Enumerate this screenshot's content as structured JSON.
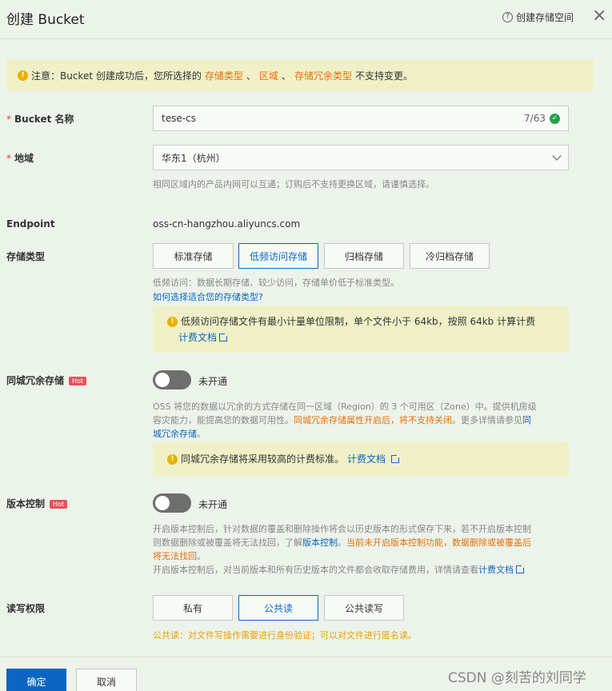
{
  "header": {
    "title": "创建 Bucket",
    "help_icon": "?",
    "help_link": "创建存储空间",
    "close_icon": "×"
  },
  "notice": {
    "prefix": "注意：Bucket 创建成功后，您所选择的",
    "hl1": "存储类型",
    "sep1": "、",
    "hl2": "区域",
    "sep2": "、",
    "hl3": "存储冗余类型",
    "suffix": "不支持变更。"
  },
  "bucket_name": {
    "required_mark": "*",
    "label": "Bucket 名称",
    "value": "tese-cs",
    "count": "7/63"
  },
  "region": {
    "required_mark": "*",
    "label": "地域",
    "value": "华东1（杭州）",
    "help": "相同区域内的产品内网可以互通；订购后不支持更换区域，请谨慎选择。"
  },
  "endpoint": {
    "label": "Endpoint",
    "value": "oss-cn-hangzhou.aliyuncs.com"
  },
  "storage_class": {
    "label": "存储类型",
    "options": [
      "标准存储",
      "低频访问存储",
      "归档存储",
      "冷归档存储"
    ],
    "selected": "低频访问存储",
    "help": "低频访问：数据长期存储、较少访问，存储单价低于标准类型。",
    "help_link": "如何选择适合您的存储类型?",
    "tip": "低频访问存储文件有最小计量单位限制，单个文件小于 64kb，按照 64kb 计算计费",
    "tip_link": "计费文档"
  },
  "zrs": {
    "label": "同城冗余存储",
    "badge": "Hot",
    "state": "未开通",
    "desc1": "OSS 将您的数据以冗余的方式存储在同一区域（Region）的 3 个可用区（Zone）中。提供机房级",
    "desc2": "容灾能力，能提高您的数据可用性。",
    "desc2_orange": "同城冗余存储属性开启后，将不支持关闭。",
    "desc2_tail": "更多详情请参见",
    "desc2_link": "同",
    "desc3_link": "城冗余存储",
    "desc3_tail": "。",
    "tip": "同城冗余存储将采用较高的计费标准。",
    "tip_link": "计费文档"
  },
  "versioning": {
    "label": "版本控制",
    "badge": "Hot",
    "state": "未开通",
    "desc1": "开启版本控制后，针对数据的覆盖和删除操作将会以历史版本的形式保存下来，若不开启版本控制",
    "desc2": "则数据删除或被覆盖将无法找回，了解",
    "desc2_link": "版本控制",
    "desc2_tail": "。",
    "desc2_orange": "当前未开启版本控制功能，数据删除或被覆盖后",
    "desc3_orange": "将无法找回。",
    "desc4": "开启版本控制后，对当前版本和所有历史版本的文件都会收取存储费用，详情请查看",
    "desc4_link": "计费文档"
  },
  "acl": {
    "label": "读写权限",
    "options": [
      "私有",
      "公共读",
      "公共读写"
    ],
    "selected": "公共读",
    "help": "公共读：对文件写操作需要进行身份验证；可以对文件进行匿名读。"
  },
  "footer": {
    "confirm": "确定",
    "cancel": "取消",
    "watermark": "CSDN @刻苦的刘同学"
  },
  "colors": {
    "accent": "#0b66c3",
    "warning": "#e4710c",
    "success": "#22a34a",
    "hot": "#e8515b"
  }
}
